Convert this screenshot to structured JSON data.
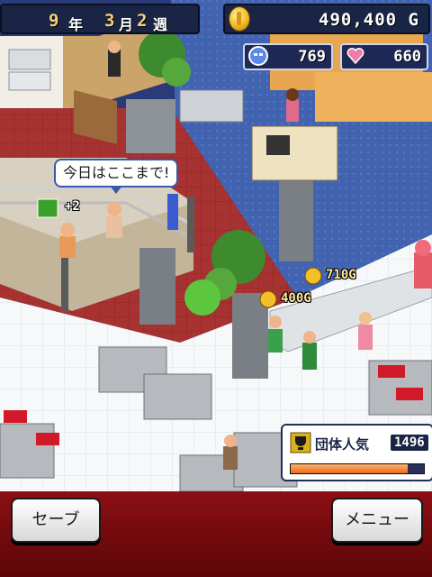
{
  "hud": {
    "year_value": "9",
    "year_unit": "年",
    "month_value": "3",
    "month_unit": "月",
    "week_value": "2",
    "week_unit": "週",
    "money": "490,400 G",
    "stat_strength": "769",
    "stat_hearts": "660"
  },
  "scene": {
    "speech_bubble": "今日はここまで!",
    "skill_bonus": "+2",
    "income_1": "710G",
    "income_2": "400G"
  },
  "popularity": {
    "label": "団体人気",
    "value": "1496",
    "fill_fraction": 0.88
  },
  "buttons": {
    "save": "セーブ",
    "menu": "メニュー"
  },
  "colors": {
    "bottom_bar": "#8b0f14",
    "hud_text": "#f6d27a"
  }
}
